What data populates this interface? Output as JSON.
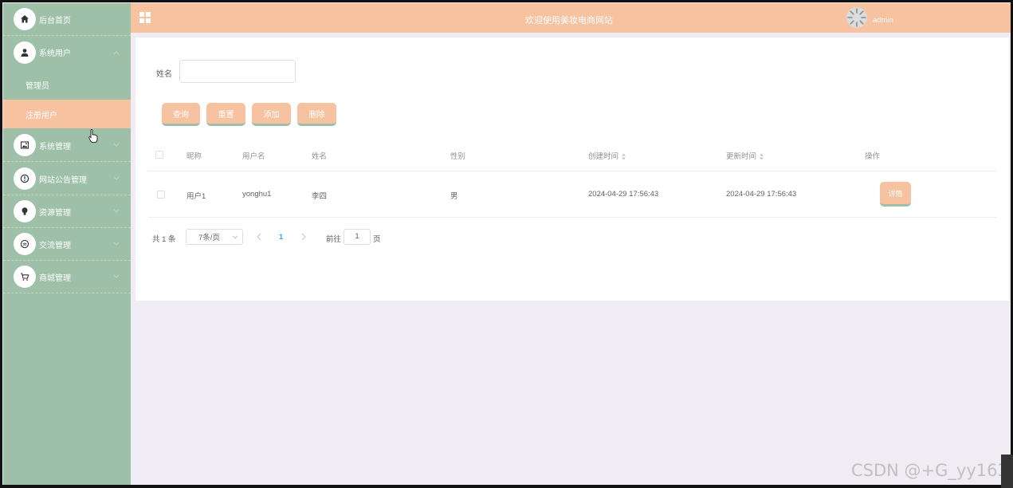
{
  "header": {
    "title": "欢迎使用美妆电商网站",
    "user": "admin"
  },
  "sidebar": {
    "items": [
      {
        "label": "后台首页",
        "icon": "home-icon"
      },
      {
        "label": "系统用户",
        "icon": "user-icon"
      },
      {
        "label": "系统管理",
        "icon": "image-icon"
      },
      {
        "label": "网站公告管理",
        "icon": "alert-icon"
      },
      {
        "label": "资源管理",
        "icon": "bulb-icon"
      },
      {
        "label": "交流管理",
        "icon": "chat-icon"
      },
      {
        "label": "商城管理",
        "icon": "cart-icon"
      }
    ],
    "submenu": [
      {
        "label": "管理员"
      },
      {
        "label": "注册用户"
      }
    ]
  },
  "search": {
    "label": "姓名",
    "value": ""
  },
  "buttons": {
    "query": "查询",
    "reset": "重置",
    "add": "添加",
    "delete": "删除"
  },
  "table": {
    "headers": [
      "昵称",
      "用户名",
      "姓名",
      "性别",
      "创建时间",
      "更新时间",
      "操作"
    ],
    "rows": [
      {
        "nickname": "用户1",
        "username": "yonghu1",
        "name": "李四",
        "gender": "男",
        "created": "2024-04-29 17:56:43",
        "updated": "2024-04-29 17:56:43",
        "action": "详情"
      }
    ]
  },
  "pagination": {
    "total": "共 1 条",
    "page_size": "7条/页",
    "current": "1",
    "goto_label": "前往",
    "goto_value": "1",
    "page_unit": "页"
  },
  "watermark": "CSDN @+G_yy163",
  "colors": {
    "sidebar": "#9ebfa8",
    "accent": "#f6c29f",
    "background": "#efedf3"
  }
}
